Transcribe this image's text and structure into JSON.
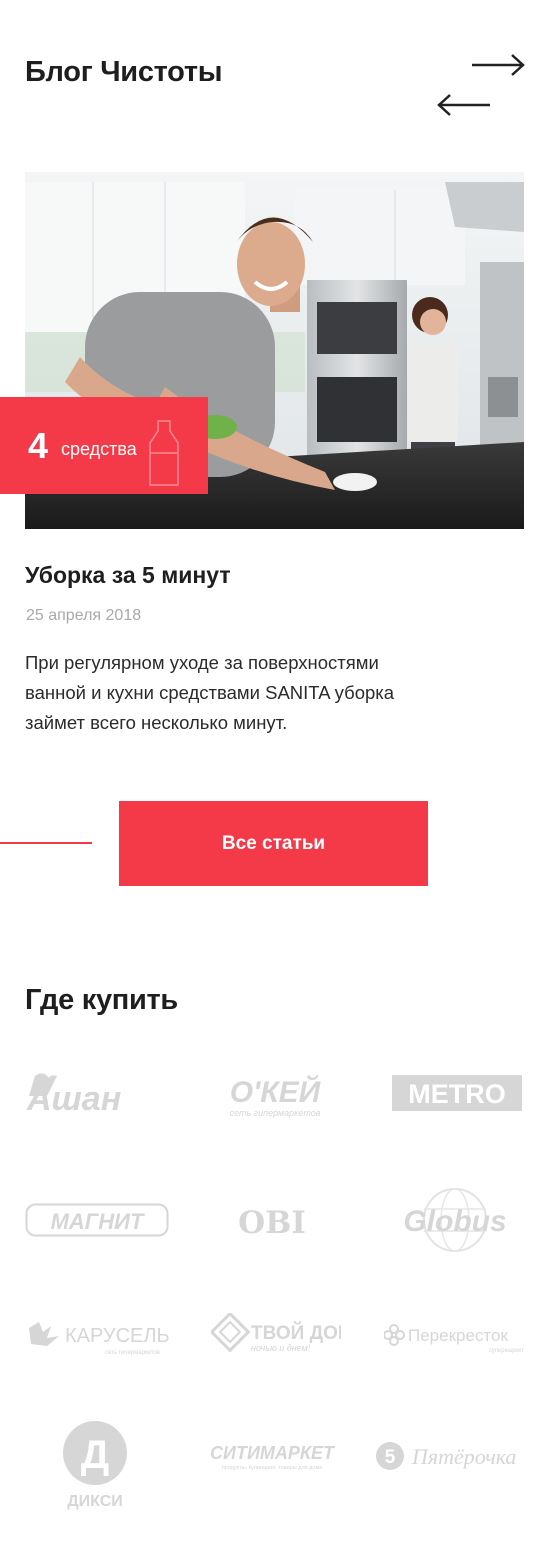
{
  "blog": {
    "title": "Блог Чистоты",
    "next_icon": "arrow-right-icon",
    "prev_icon": "arrow-left-icon"
  },
  "article": {
    "badge_number": "4",
    "badge_label": "средства",
    "badge_icon": "bottle-icon",
    "title": "Уборка за 5 минут",
    "date": "25 апреля 2018",
    "lines": [
      "При регулярном уходе за поверхностями",
      "ванной и кухни средствами SANITA уборка",
      "займет всего несколько минут."
    ]
  },
  "all_articles_button": "Все статьи",
  "where_to_buy": {
    "title": "Где купить",
    "stores": [
      {
        "name": "Ашан",
        "text": "Ашан"
      },
      {
        "name": "О'КЕЙ",
        "text": "О'КЕЙ",
        "sub": "сеть гипермаркетов"
      },
      {
        "name": "METRO",
        "text": "METRO"
      },
      {
        "name": "МАГНИТ",
        "text": "МАГНИТ"
      },
      {
        "name": "OBI",
        "text": "OBI"
      },
      {
        "name": "Globus",
        "text": "Globus"
      },
      {
        "name": "КАРУСЕЛЬ",
        "text": "КАРУСЕЛЬ",
        "sub": "сеть гипермаркетов"
      },
      {
        "name": "Твой Дом",
        "text": "ТВОЙ ДОМ",
        "sub": "ночью и днем!"
      },
      {
        "name": "Перекресток",
        "text": "Перекресток",
        "sub": "супермаркет"
      },
      {
        "name": "Дикси",
        "text": "ДИКСИ",
        "mark": "Д"
      },
      {
        "name": "Ситимаркет",
        "text": "СИТИМАРКЕТ",
        "sub": "продукты, кулинария, товары для дома"
      },
      {
        "name": "Пятёрочка",
        "text": "Пятёрочка",
        "mark": "5"
      }
    ]
  },
  "colors": {
    "accent": "#f43a48",
    "text": "#1e1e1e",
    "muted": "#a9a9a9",
    "logo": "#d6d6d6"
  }
}
